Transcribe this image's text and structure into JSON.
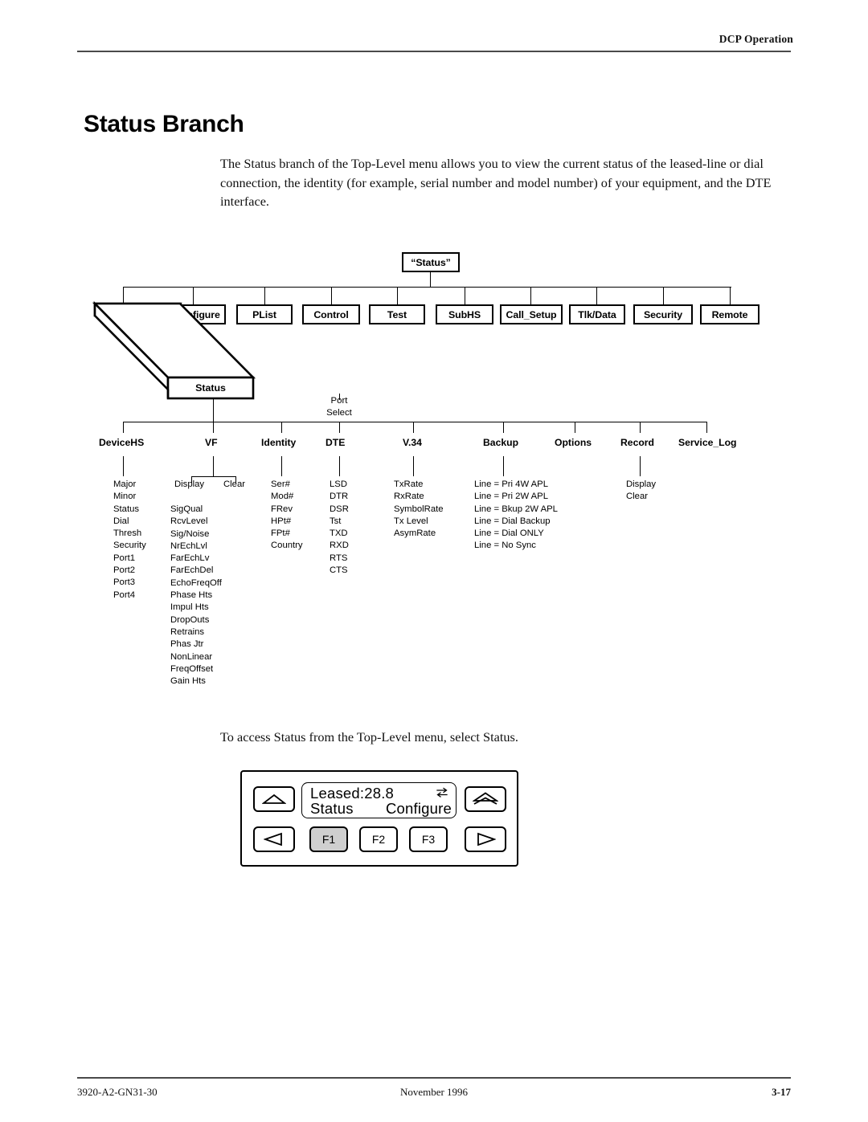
{
  "header": {
    "running_head": "DCP Operation"
  },
  "title": "Status Branch",
  "intro": "The Status branch of the Top-Level menu allows you to view the current status of the leased-line or dial connection, the identity (for example, serial number and model number) of your equipment, and the DTE interface.",
  "diagram": {
    "root_label": "“Status”",
    "top_level": [
      {
        "label": "Configure"
      },
      {
        "label": "PList"
      },
      {
        "label": "Control"
      },
      {
        "label": "Test"
      },
      {
        "label": "SubHS"
      },
      {
        "label": "Call_Setup"
      },
      {
        "label": "Tlk/Data"
      },
      {
        "label": "Security"
      },
      {
        "label": "Remote"
      }
    ],
    "highlight_box_label": "Status",
    "port_select_note": "Port\nSelect",
    "port_select_line1": "Port",
    "port_select_line2": "Select",
    "level2": [
      {
        "label": "DeviceHS"
      },
      {
        "label": "VF"
      },
      {
        "label": "Identity"
      },
      {
        "label": "DTE"
      },
      {
        "label": "V.34"
      },
      {
        "label": "Backup"
      },
      {
        "label": "Options"
      },
      {
        "label": "Record"
      },
      {
        "label": "Service_Log"
      }
    ],
    "columns": {
      "deviceHS": [
        "Major",
        "Minor",
        "Status",
        "Dial",
        "Thresh",
        "Security",
        "Port1",
        "Port2",
        "Port3",
        "Port4"
      ],
      "vf_display": "Display",
      "vf_clear": "Clear",
      "vf": [
        "SigQual",
        "RcvLevel",
        "Sig/Noise",
        "NrEchLvl",
        "FarEchLv",
        "FarEchDel",
        "EchoFreqOff",
        "Phase Hts",
        "Impul Hts",
        "DropOuts",
        "Retrains",
        "Phas Jtr",
        "NonLinear",
        "FreqOffset",
        "Gain Hts"
      ],
      "identity": [
        "Ser#",
        "Mod#",
        "FRev",
        "HPt#",
        "FPt#",
        "Country"
      ],
      "dte": [
        "LSD",
        "DTR",
        "DSR",
        "Tst",
        "TXD",
        "RXD",
        "RTS",
        "CTS"
      ],
      "v34": [
        "TxRate",
        "RxRate",
        "SymbolRate",
        "Tx Level",
        "AsymRate"
      ],
      "backup": [
        "Line = Pri 4W APL",
        "Line = Pri 2W APL",
        "Line = Bkup 2W APL",
        "Line = Dial Backup",
        "Line = Dial ONLY",
        "Line = No Sync"
      ],
      "record": [
        "Display",
        "Clear"
      ]
    }
  },
  "access_text": "To access Status from the Top-Level menu, select Status.",
  "panel": {
    "lcd_line1": "Leased:28.8",
    "lcd_line2_left": "Status",
    "lcd_line2_right": "Configure",
    "lcd_icon": "data-transfer-arrows-icon",
    "keys": {
      "up_arrow": "up-triangle-icon",
      "enter": "double-up-triangle-icon",
      "left_arrow": "left-triangle-icon",
      "right_arrow": "right-triangle-icon",
      "f1": "F1",
      "f2": "F2",
      "f3": "F3"
    }
  },
  "footer": {
    "left": "3920-A2-GN31-30",
    "center": "November 1996",
    "right": "3-17"
  }
}
